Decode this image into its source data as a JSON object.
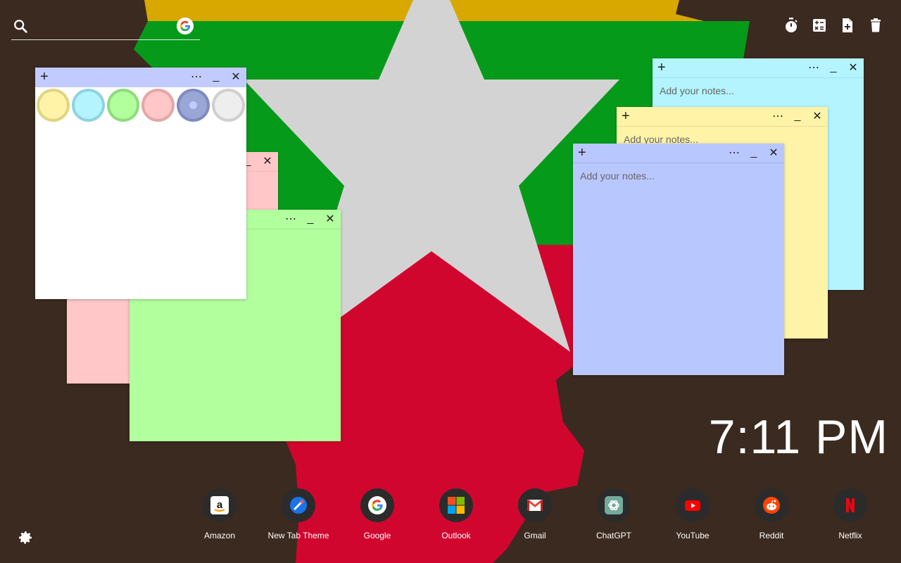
{
  "search": {
    "placeholder": "",
    "icon": "search-icon",
    "engine_icon": "google-icon"
  },
  "toolbar": [
    "timer-icon",
    "calculator-icon",
    "new-note-icon",
    "trash-icon"
  ],
  "notes": {
    "placeholder": "Add your notes...",
    "plus": "+",
    "menu": "⋯",
    "minimize": "_",
    "close": "✕"
  },
  "palette": [
    "#fff3a8",
    "#b3f4ff",
    "#b2ff9e",
    "#ffc7c7",
    "#9aa6d6",
    "#eeeeee"
  ],
  "clock": {
    "time": "7:11 PM"
  },
  "shortcuts": [
    {
      "label": "Amazon",
      "icon": "amazon-icon"
    },
    {
      "label": "New Tab Theme",
      "icon": "new-tab-theme-icon"
    },
    {
      "label": "Google",
      "icon": "google-icon"
    },
    {
      "label": "Outlook",
      "icon": "outlook-icon"
    },
    {
      "label": "Gmail",
      "icon": "gmail-icon"
    },
    {
      "label": "ChatGPT",
      "icon": "chatgpt-icon"
    },
    {
      "label": "YouTube",
      "icon": "youtube-icon"
    },
    {
      "label": "Reddit",
      "icon": "reddit-icon"
    },
    {
      "label": "Netflix",
      "icon": "netflix-icon"
    }
  ],
  "colors": {
    "flag_yellow": "#d8a700",
    "flag_green": "#069a1a",
    "flag_red": "#d0062e",
    "star": "#d3d3d3",
    "background": "#3b2a1f"
  }
}
